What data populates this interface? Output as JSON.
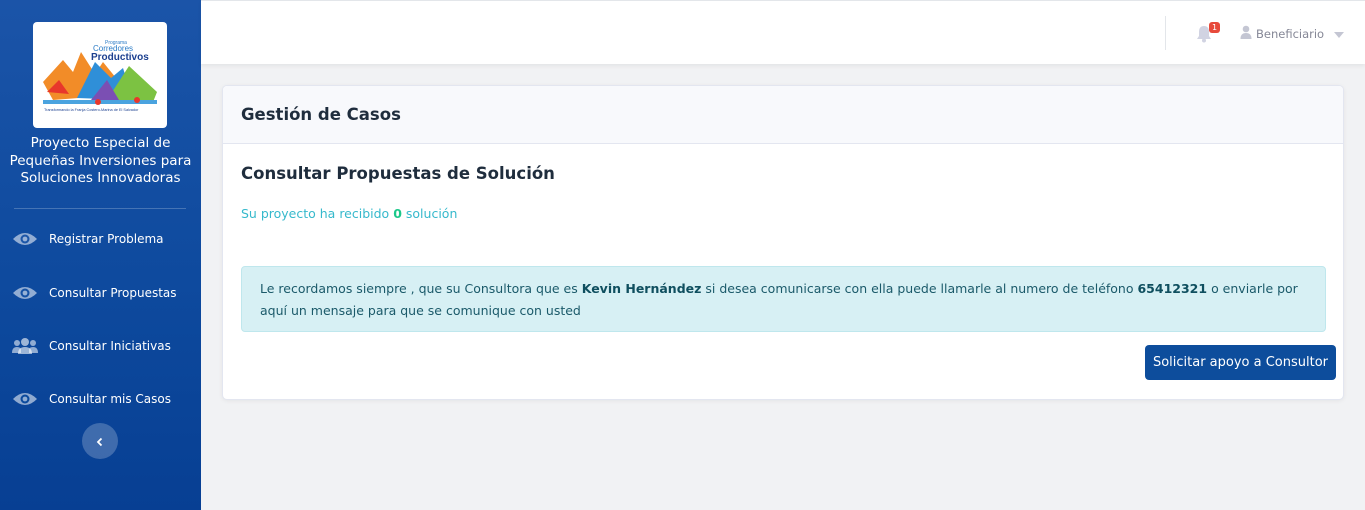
{
  "sidebar": {
    "logo": {
      "program_label": "Programa",
      "brand_line1": "Corredores",
      "brand_line2": "Productivos",
      "tagline": "Transformando la Franja Costero-Marina de El Salvador"
    },
    "title": "Proyecto Especial de Pequeñas Inversiones para Soluciones Innovadoras",
    "items": [
      {
        "label": "Registrar Problema",
        "icon": "eye-icon"
      },
      {
        "label": "Consultar Propuestas",
        "icon": "eye-icon"
      },
      {
        "label": "Consultar Iniciativas",
        "icon": "users-icon"
      },
      {
        "label": "Consultar mis Casos",
        "icon": "eye-icon"
      }
    ],
    "collapse_icon": "chevron-left-icon"
  },
  "topbar": {
    "notification_count": "1",
    "user_name": "Beneficiario"
  },
  "card": {
    "header": "Gestión de Casos",
    "section_title": "Consultar Propuestas de Solución",
    "count_prefix": "Su proyecto ha recibido",
    "count_value": "0",
    "count_suffix": "solución",
    "alert": {
      "text1": "Le recordamos siempre , que su Consultora que es",
      "consultant": "Kevin Hernández",
      "text2": "si desea comunicarse con ella puede llamarle al numero de teléfono",
      "phone": "65412321",
      "text3": "o enviarle por aquí un mensaje para que se comunique con usted"
    },
    "button": "Solicitar apoyo a Consultor"
  },
  "colors": {
    "sidebar": "#0e4a9e",
    "primary_button": "#0d4d9c",
    "alert_bg": "#d7f0f4",
    "info_text": "#36b9cc",
    "success": "#1cc88a",
    "badge": "#e74a3b"
  }
}
